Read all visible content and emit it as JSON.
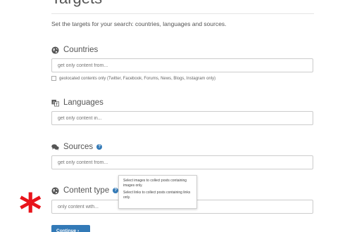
{
  "page": {
    "title": "Targets",
    "intro": "Set the targets for your search: countries, languages and sources."
  },
  "countries": {
    "label": "Countries",
    "icon": "globe-icon",
    "placeholder": "get only content from...",
    "checkbox_label": "geolocated contents only (Twitter, Facebook, Forums, News, Blogs, Instagram only)"
  },
  "languages": {
    "label": "Languages",
    "icon": "translate-icon",
    "placeholder": "get only content in..."
  },
  "sources": {
    "label": "Sources",
    "icon": "comments-icon",
    "help": "?",
    "placeholder": "get only content from..."
  },
  "content_type": {
    "label": "Content type",
    "icon": "globe-icon",
    "help": "?",
    "placeholder": "only content with...",
    "tooltip_line1": "Select images to collect posts containing images only.",
    "tooltip_line2": "Select links to collect posts containing links only."
  },
  "annotation": {
    "symbol": "*",
    "color": "#e8141b"
  },
  "actions": {
    "continue_label": "Continue ›"
  },
  "colors": {
    "accent": "#337ab7",
    "text": "#555555",
    "border": "#cccccc"
  }
}
